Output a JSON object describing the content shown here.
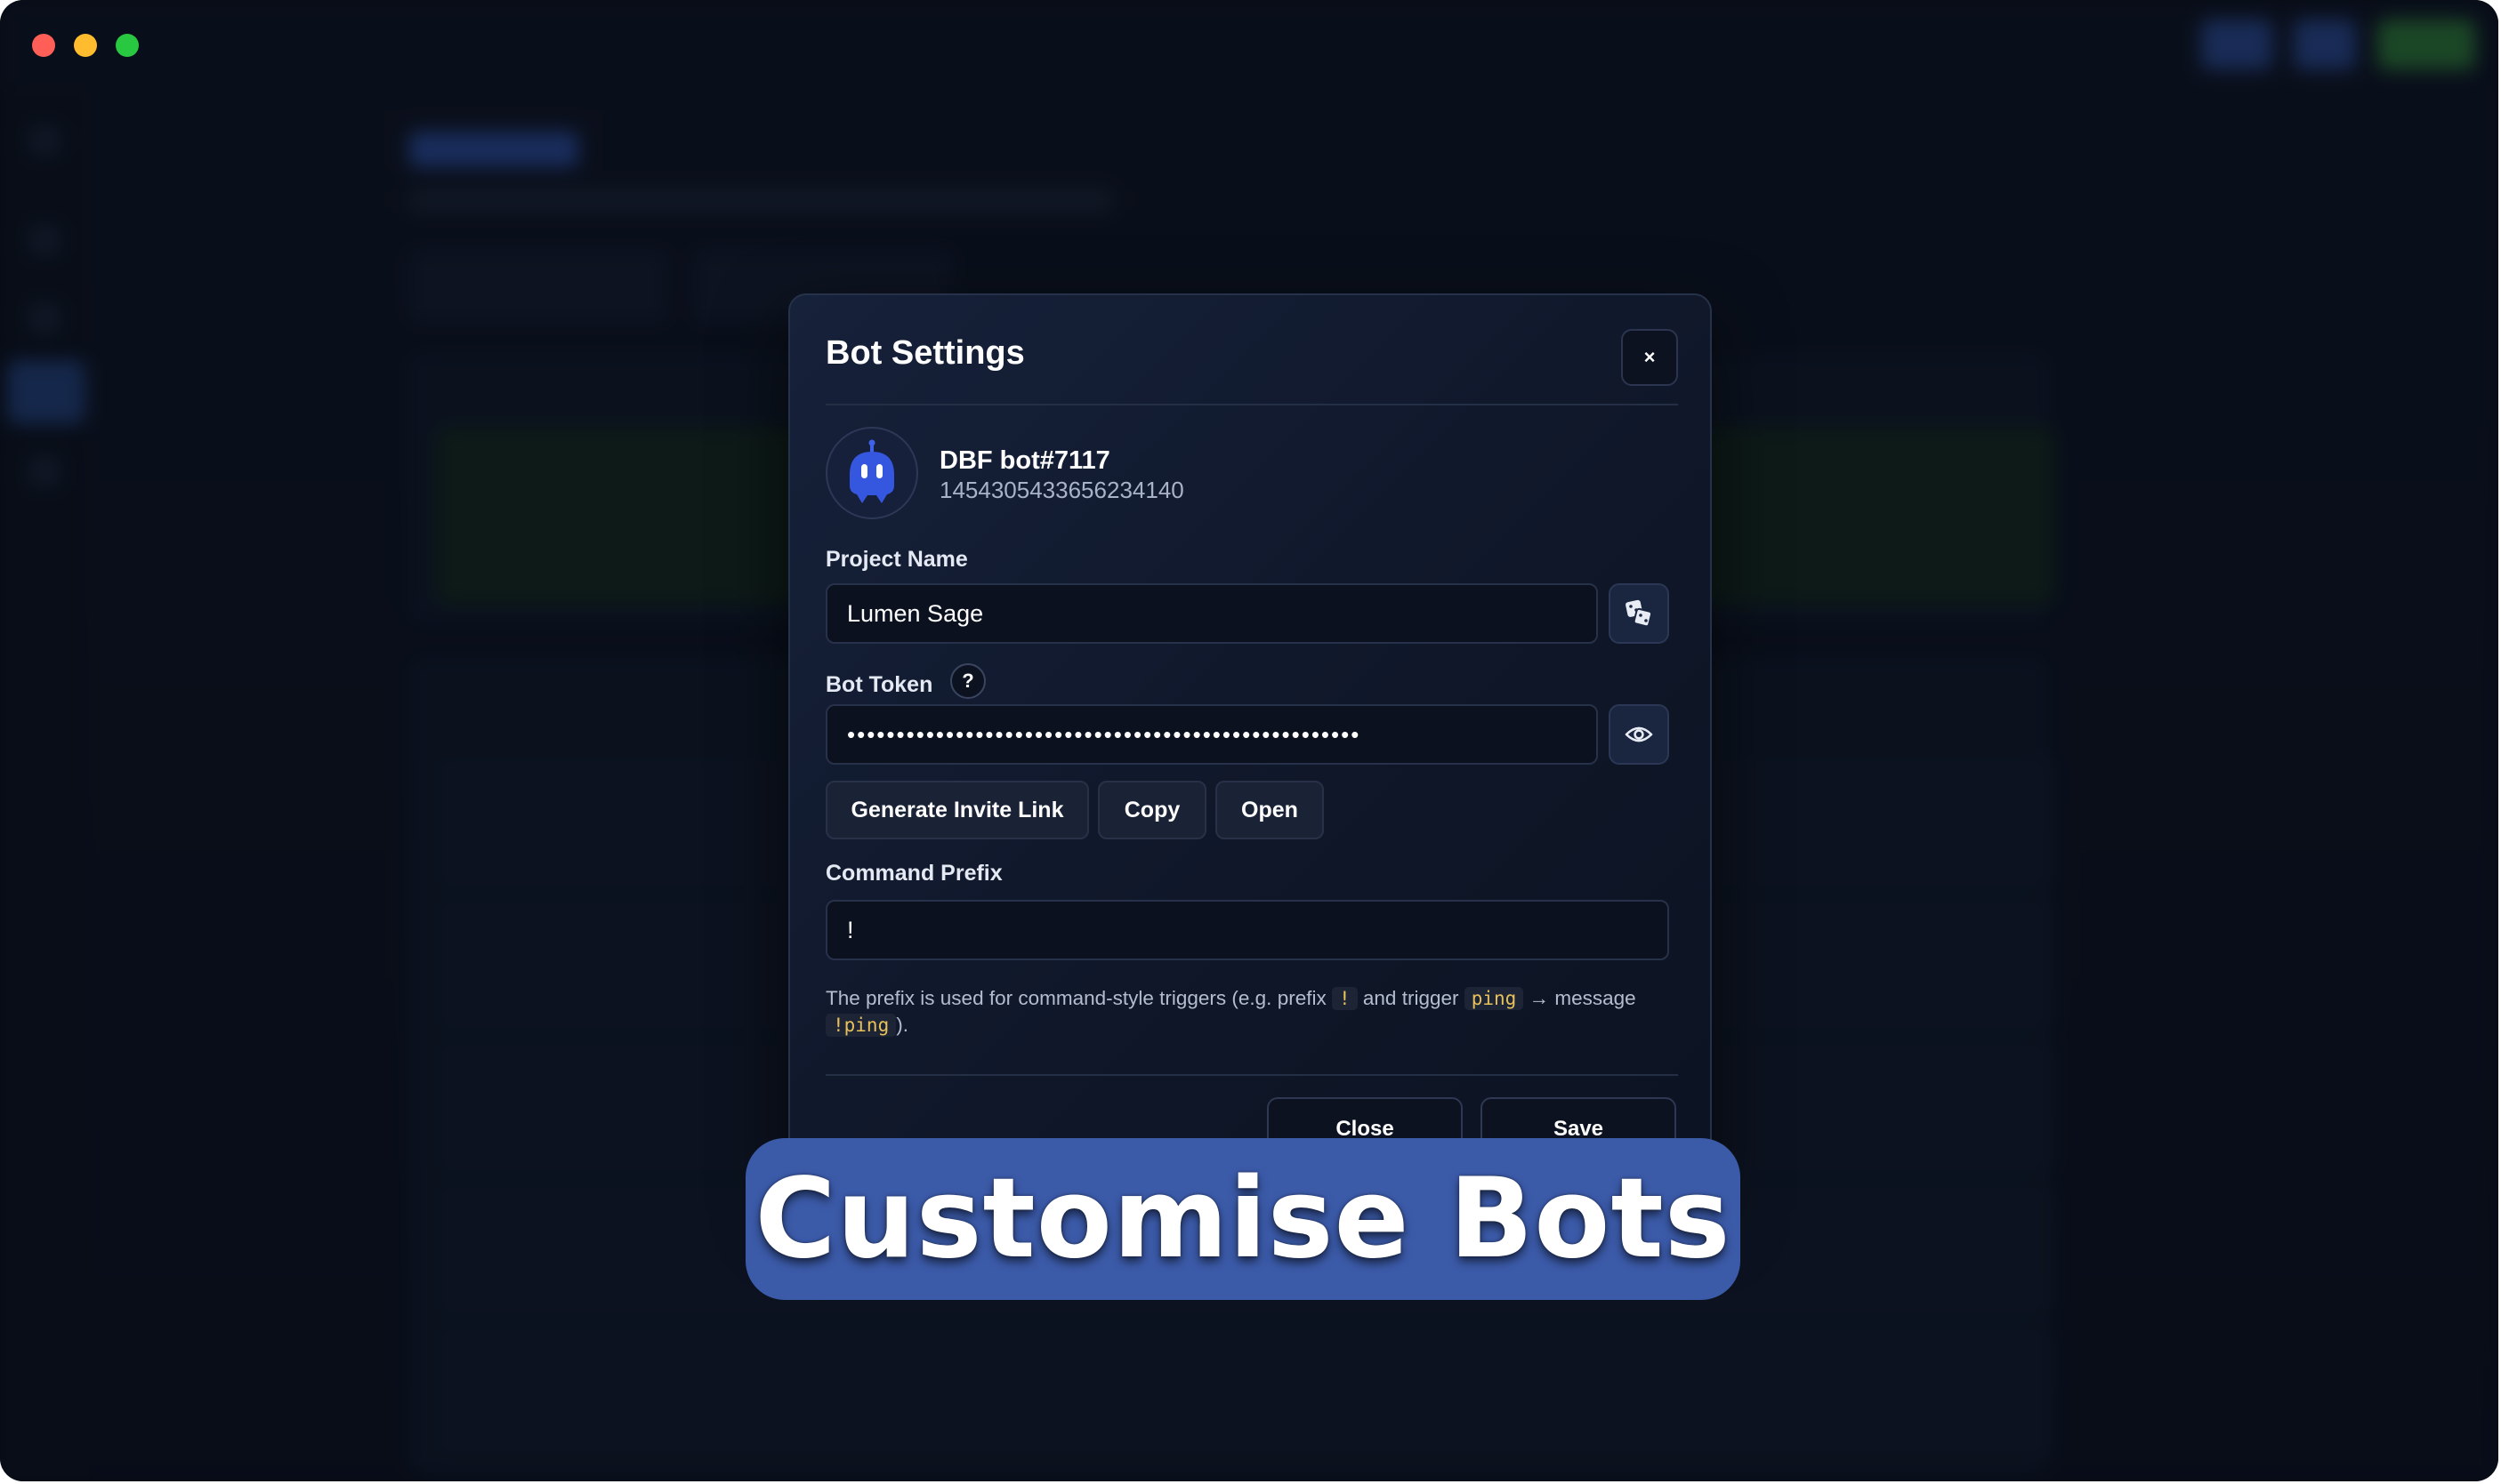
{
  "window": {
    "traffic_lights": {
      "close": "#ff5f57",
      "minimize": "#febc2e",
      "zoom": "#28c840"
    }
  },
  "modal": {
    "title": "Bot Settings",
    "close_glyph": "×",
    "bot": {
      "name": "DBF bot#7117",
      "id": "1454305433656234140",
      "avatar_icon": "robot-icon"
    },
    "project_name": {
      "label": "Project Name",
      "value": "Lumen Sage",
      "action_icon": "dice-icon"
    },
    "bot_token": {
      "label": "Bot Token",
      "help_glyph": "?",
      "masked_value": "••••••••••••••••••••••••••••••••••••••••••••••••••••",
      "action_icon": "eye-icon"
    },
    "token_actions": {
      "generate": "Generate Invite Link",
      "copy": "Copy",
      "open": "Open"
    },
    "command_prefix": {
      "label": "Command Prefix",
      "value": "!",
      "help": {
        "t1": "The prefix is used for command-style triggers (e.g. prefix",
        "c1": "!",
        "t2": "and trigger",
        "c2": "ping",
        "t3": "→ message",
        "c3": "!ping",
        "t4": ")."
      }
    },
    "footer": {
      "close": "Close",
      "save": "Save"
    }
  },
  "banner": {
    "text": "Customise Bots",
    "color": "#3b5aa8"
  }
}
